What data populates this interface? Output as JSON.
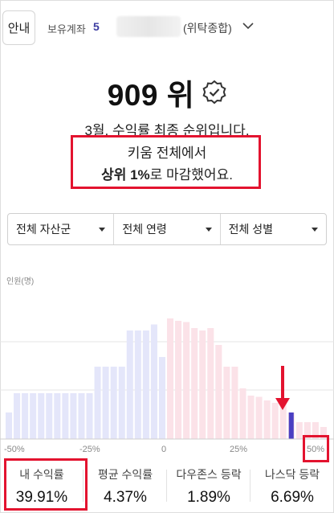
{
  "topbar": {
    "guide_label": "안내",
    "account_label": "보유계좌",
    "account_count": "5",
    "account_type": "(위탁종합)"
  },
  "rank": {
    "value": "909 위",
    "line1": "3월, 수익률 최종 순위입니다.",
    "line2": "키움 전체에서",
    "line3_bold": "상위 1%",
    "line3_rest": "로 마감했어요."
  },
  "filters": [
    {
      "label": "전체 자산군"
    },
    {
      "label": "전체 연령"
    },
    {
      "label": "전체 성별"
    }
  ],
  "chart_data": {
    "type": "bar",
    "ylabel": "인원(명)",
    "x_ticks": [
      "-50%",
      "-25%",
      "0",
      "25%",
      "50%"
    ],
    "xlim": [
      -50,
      50
    ],
    "bin_width": 2.5,
    "bins_start": [
      -50,
      -47.5,
      -45,
      -42.5,
      -40,
      -37.5,
      -35,
      -32.5,
      -30,
      -27.5,
      -25,
      -22.5,
      -20,
      -17.5,
      -15,
      -12.5,
      -10,
      -7.5,
      -5,
      -2.5,
      0,
      2.5,
      5,
      7.5,
      10,
      12.5,
      15,
      17.5,
      20,
      22.5,
      25,
      27.5,
      30,
      32.5,
      35,
      37.5,
      40,
      42.5,
      45,
      47.5
    ],
    "values": [
      22,
      38,
      38,
      38,
      38,
      38,
      38,
      38,
      38,
      38,
      38,
      60,
      60,
      60,
      60,
      90,
      90,
      90,
      95,
      68,
      100,
      98,
      97,
      92,
      90,
      92,
      78,
      60,
      60,
      42,
      36,
      35,
      32,
      30,
      30,
      22,
      14,
      14,
      14,
      10
    ],
    "highlight_bin_start": 37.5,
    "colors": {
      "negative": "#e4e6fa",
      "positive": "#fbe2e8",
      "highlight": "#4a3fc2"
    }
  },
  "stats": [
    {
      "label": "내 수익률",
      "value": "39.91%"
    },
    {
      "label": "평균 수익률",
      "value": "4.37%"
    },
    {
      "label": "다우존스 등락",
      "value": "1.89%"
    },
    {
      "label": "나스닥 등락",
      "value": "6.69%"
    }
  ]
}
